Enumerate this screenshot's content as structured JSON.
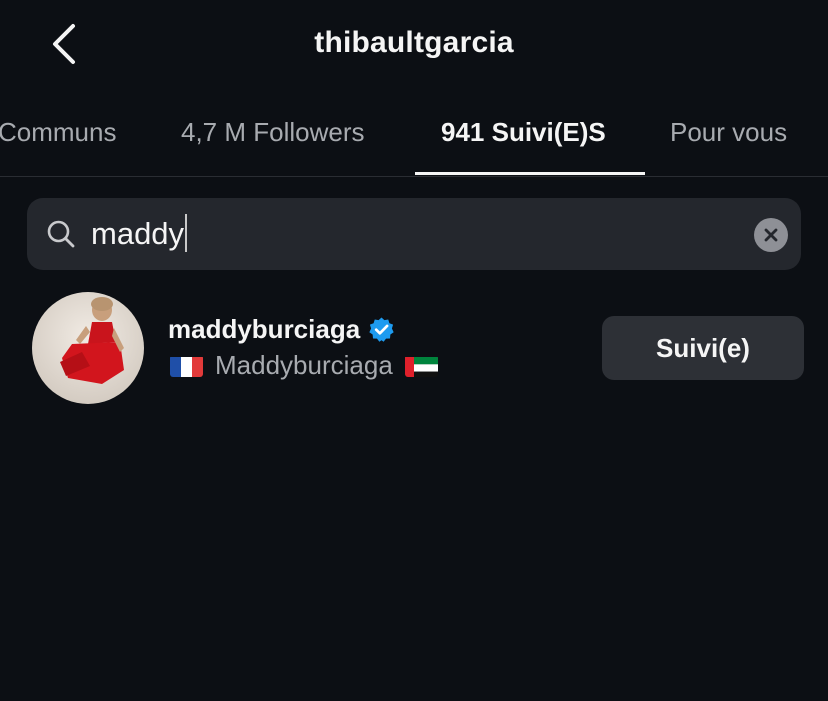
{
  "header": {
    "title": "thibaultgarcia",
    "back_icon": "chevron-left-icon"
  },
  "tabs": [
    {
      "label": "Communs",
      "active": false
    },
    {
      "label": "4,7 M Followers",
      "active": false
    },
    {
      "label": "941 Suivi(E)S",
      "active": true
    },
    {
      "label": "Pour vous",
      "active": false
    }
  ],
  "search": {
    "value": "maddy",
    "icon": "search-icon",
    "clear_icon": "clear-icon"
  },
  "results": [
    {
      "username": "maddyburciaga",
      "verified": true,
      "full_name": "Maddyburciaga",
      "flag_before": "france-flag",
      "flag_after": "uae-flag",
      "button_label": "Suivi(e)"
    }
  ],
  "colors": {
    "background": "#0c0f14",
    "search_bg": "#24272d",
    "button_bg": "#2d3036",
    "verified_blue": "#1d9bf0",
    "muted_text": "#a8abb0"
  }
}
